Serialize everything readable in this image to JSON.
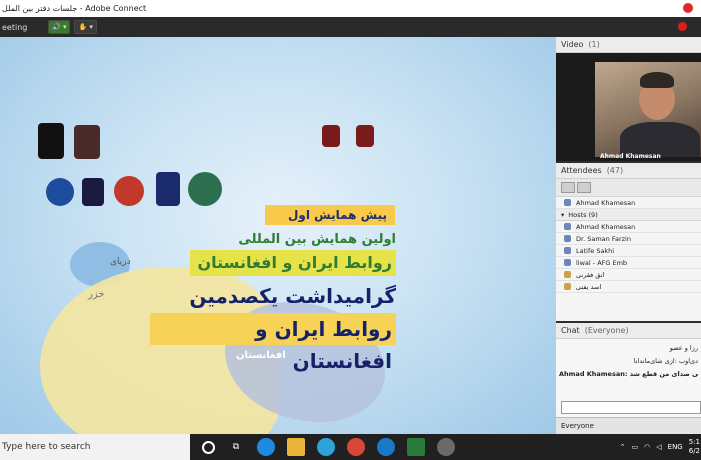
{
  "window": {
    "title": "جلسات دفتر بین الملل - Adobe Connect"
  },
  "toolbar": {
    "meeting_label": "eeting"
  },
  "slide": {
    "badge": "پیش همایش اول",
    "line2": "اولین همایش بین المللی",
    "line3": "روابط ایران و افغانستان",
    "line4": "گرامیداشت یکصدمین سال",
    "line5": "روابط ایران و افغانستان",
    "map_label_afg": "افغانستان",
    "map_label_khazar": "دریای",
    "map_label_khazar2": "خزر"
  },
  "video_pod": {
    "title": "Video",
    "count": "(1)",
    "name": "Ahmad Khamesan"
  },
  "attendees_pod": {
    "title": "Attendees",
    "count": "(47)",
    "presenter": "Ahmad Khamesan",
    "hosts_label": "Hosts (9)",
    "hosts": [
      "Ahmad Khamesan",
      "Dr. Saman Farzin",
      "Latife Sakhi",
      "liwal - AFG Emb",
      "انق فقرنی",
      "اسد يفتی"
    ]
  },
  "chat_pod": {
    "title": "Chat",
    "scope": "(Everyone)",
    "messages": [
      "رزا و عصو",
      "دی‌اوب :ازی شای‌ماندانا",
      "Ahmad Khamesan: کر دسترسی صدای من قطع شد"
    ],
    "recipient": "Everyone"
  },
  "taskbar": {
    "search_placeholder": "Type here to search",
    "lang": "ENG",
    "time": "5:1",
    "date": "6/2"
  }
}
